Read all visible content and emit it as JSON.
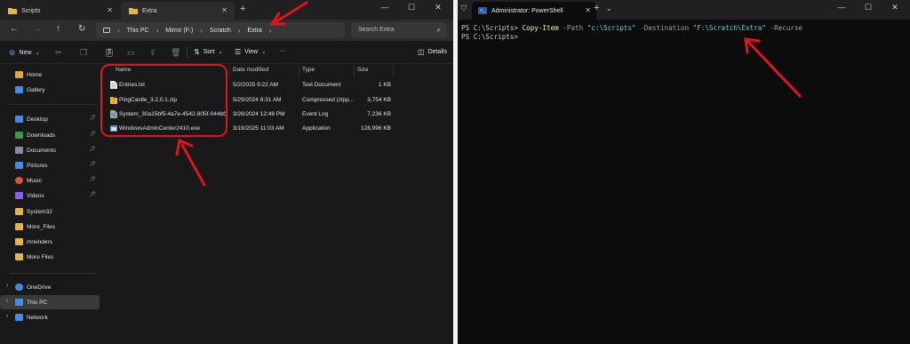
{
  "explorer": {
    "tabs": [
      {
        "label": "Scripts"
      },
      {
        "label": "Extra"
      }
    ],
    "new_tab_glyph": "+",
    "window_controls": [
      "—",
      "☐",
      "✕"
    ],
    "nav": {
      "back": "←",
      "forward": "→",
      "up": "↑",
      "refresh": "↻"
    },
    "breadcrumb": [
      "This PC",
      "Mirror (F:)",
      "Scratch",
      "Extra"
    ],
    "search_placeholder": "Search Extra",
    "toolbar": {
      "new_label": "New",
      "sort_label": "Sort",
      "view_label": "View",
      "more_label": "···",
      "details_label": "Details"
    },
    "sidebar": {
      "top": [
        {
          "label": "Home",
          "icon": "home-icon",
          "color": "#e9a23b"
        },
        {
          "label": "Gallery",
          "icon": "gallery-icon",
          "color": "#3b8ee9"
        }
      ],
      "pinned": [
        {
          "label": "Desktop",
          "icon": "desktop-icon",
          "color": "#3b8ee9"
        },
        {
          "label": "Downloads",
          "icon": "downloads-icon",
          "color": "#2ea043"
        },
        {
          "label": "Documents",
          "icon": "documents-icon",
          "color": "#7f8ea3"
        },
        {
          "label": "Pictures",
          "icon": "pictures-icon",
          "color": "#3b8ee9"
        },
        {
          "label": "Music",
          "icon": "music-icon",
          "color": "#e0543b"
        },
        {
          "label": "Videos",
          "icon": "videos-icon",
          "color": "#8b5cf6"
        },
        {
          "label": "System32",
          "icon": "folder-icon",
          "color": "#e9b53b"
        },
        {
          "label": "More_Files",
          "icon": "folder-icon",
          "color": "#e9b53b"
        },
        {
          "label": "mreinders",
          "icon": "folder-icon",
          "color": "#e9b53b"
        },
        {
          "label": "More Files",
          "icon": "folder-icon",
          "color": "#e9b53b"
        }
      ],
      "drives": [
        {
          "label": "OneDrive",
          "icon": "cloud-icon",
          "color": "#3b8ee9"
        },
        {
          "label": "This PC",
          "icon": "pc-icon",
          "color": "#3b8ee9"
        },
        {
          "label": "Network",
          "icon": "network-icon",
          "color": "#3b8ee9"
        }
      ]
    },
    "columns": [
      "Name",
      "Date modified",
      "Type",
      "Size"
    ],
    "files": [
      {
        "name": "Entries.txt",
        "date": "5/2/2025 9:22 AM",
        "type": "Text Document",
        "size": "1 KB",
        "icon": "text-file-icon",
        "color": "#d9d9d9"
      },
      {
        "name": "PingCastle_3.2.0.1.zip",
        "date": "5/29/2024 8:31 AM",
        "type": "Compressed (zipp...",
        "size": "3,754 KB",
        "icon": "zip-folder-icon",
        "color": "#e9b53b"
      },
      {
        "name": "System_30a15bf5-4a7e-4542-805f-044bf2...",
        "date": "3/26/2024 12:48 PM",
        "type": "Event Log",
        "size": "7,236 KB",
        "icon": "event-log-icon",
        "color": "#9aa3ad"
      },
      {
        "name": "WindowsAdminCenter2410.exe",
        "date": "3/19/2025 11:03 AM",
        "type": "Application",
        "size": "128,996 KB",
        "icon": "exe-icon",
        "color": "#4a90d9"
      }
    ]
  },
  "powershell": {
    "tab_title": "Administrator: PowerShell",
    "tab_icon_glyph": ">_",
    "new_tab_glyph": "+",
    "dropdown_glyph": "⌄",
    "window_controls": [
      "—",
      "☐",
      "✕"
    ],
    "lines": [
      {
        "prompt": "PS C:\\Scripts> ",
        "cmd": "Copy-Item",
        "p1": " -Path ",
        "v1": "\"c:\\Scripts\"",
        "p2": " -Destination ",
        "v2": "\"F:\\Scratch\\Extra\"",
        "p3": " -Recurse"
      },
      {
        "prompt": "PS C:\\Scripts>"
      }
    ]
  },
  "colors": {
    "annotation": "#e0141c",
    "explorer_bg": "#191919",
    "terminal_bg": "#0c0c0c"
  }
}
